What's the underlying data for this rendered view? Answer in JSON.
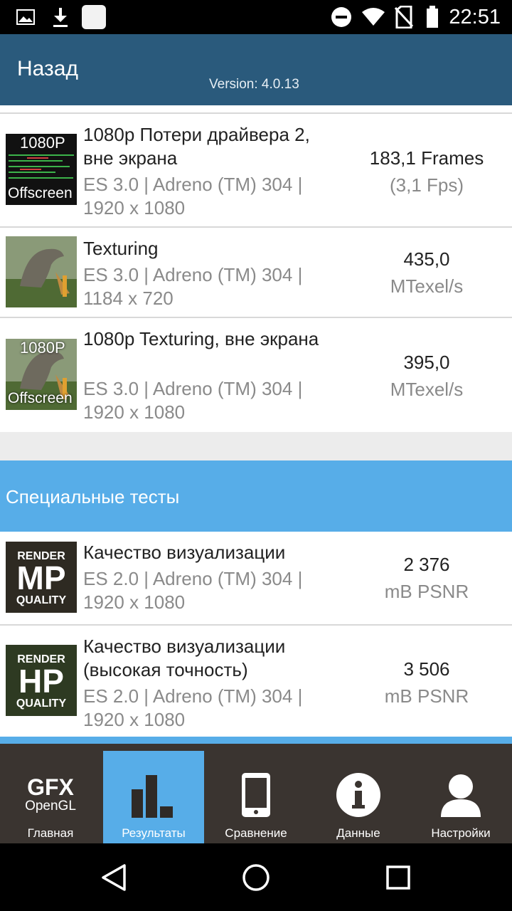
{
  "status_bar": {
    "time": "22:51",
    "left_icons": [
      "image-icon",
      "download-icon",
      "app-icon"
    ],
    "right_icons": [
      "do-not-disturb-icon",
      "wifi-icon",
      "no-sim-icon",
      "battery-icon"
    ]
  },
  "header": {
    "back_label": "Назад",
    "version": "Version: 4.0.13"
  },
  "results": [
    {
      "thumb": {
        "type": "offscreen-driver",
        "line1": "1080P",
        "line2": "Offscreen"
      },
      "title": "1080p Потери драйвера 2, вне экрана",
      "subtitle": "ES 3.0 | Adreno (TM) 304 | 1920 x 1080",
      "value": "183,1 Frames",
      "unit": "(3,1 Fps)"
    },
    {
      "thumb": {
        "type": "dino"
      },
      "title": "Texturing",
      "subtitle": "ES 3.0 | Adreno (TM) 304 | 1184 x 720",
      "value": "435,0",
      "unit": "MTexel/s"
    },
    {
      "thumb": {
        "type": "dino-offscreen",
        "line1": "1080P",
        "line2": "Offscreen"
      },
      "title": "1080p Texturing, вне экрана",
      "subtitle": "ES 3.0 | Adreno (TM) 304 | 1920 x 1080",
      "value": "395,0",
      "unit": "MTexel/s"
    }
  ],
  "special_section": {
    "title": "Специальные тесты",
    "items": [
      {
        "thumb": {
          "top": "RENDER",
          "big": "MP",
          "bottom": "QUALITY"
        },
        "title": "Качество визуализации",
        "subtitle": "ES 2.0 | Adreno (TM) 304 | 1920 x 1080",
        "value": "2 376",
        "unit": "mB PSNR"
      },
      {
        "thumb": {
          "top": "RENDER",
          "big": "HP",
          "bottom": "QUALITY"
        },
        "title": "Качество визуализации (высокая точность)",
        "subtitle": "ES 2.0 | Adreno (TM) 304 | 1920 x 1080",
        "value": "3 506",
        "unit": "mB PSNR"
      }
    ]
  },
  "bottom_nav": {
    "logo_line1": "GFX",
    "logo_line2": "OpenGL",
    "tabs": [
      {
        "label": "Главная",
        "icon": "gfx-logo-icon"
      },
      {
        "label": "Результаты",
        "icon": "bar-chart-icon",
        "active": true
      },
      {
        "label": "Сравнение",
        "icon": "phone-icon"
      },
      {
        "label": "Данные",
        "icon": "info-icon"
      },
      {
        "label": "Настройки",
        "icon": "user-icon"
      }
    ]
  },
  "system_nav": [
    "back-icon",
    "home-icon",
    "recents-icon"
  ],
  "colors": {
    "header_bg": "#2a5a7c",
    "accent": "#57ade8",
    "nav_bg": "#3a3430"
  }
}
